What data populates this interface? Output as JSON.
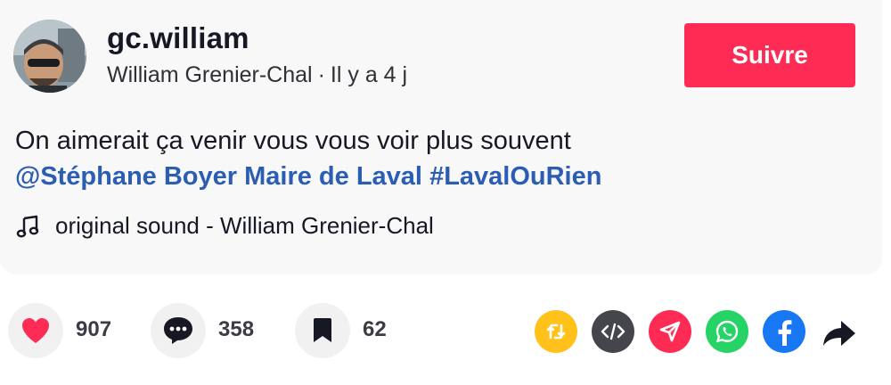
{
  "author": {
    "username": "gc.william",
    "display_name": "William Grenier-Chal",
    "separator": "·",
    "posted": "Il y a 4 j"
  },
  "follow_button": {
    "label": "Suivre"
  },
  "description": {
    "text": "On aimerait ça venir vous vous voir plus souvent",
    "mention": "@Stéphane Boyer Maire de Laval",
    "hashtag": "#LavalOuRien"
  },
  "sound": {
    "label": "original sound - William Grenier-Chal"
  },
  "stats": {
    "likes": "907",
    "comments": "358",
    "saves": "62"
  },
  "share_targets": [
    "repost-icon",
    "embed-icon",
    "send-icon",
    "whatsapp-icon",
    "facebook-icon",
    "share-arrow-icon"
  ],
  "colors": {
    "follow": "#fe2c55",
    "like": "#fe2c55",
    "repost": "#ffc11a",
    "embed": "#45464c",
    "send": "#fe2c55",
    "whatsapp": "#25d366",
    "facebook": "#1877f2",
    "link": "#2b5db3"
  }
}
